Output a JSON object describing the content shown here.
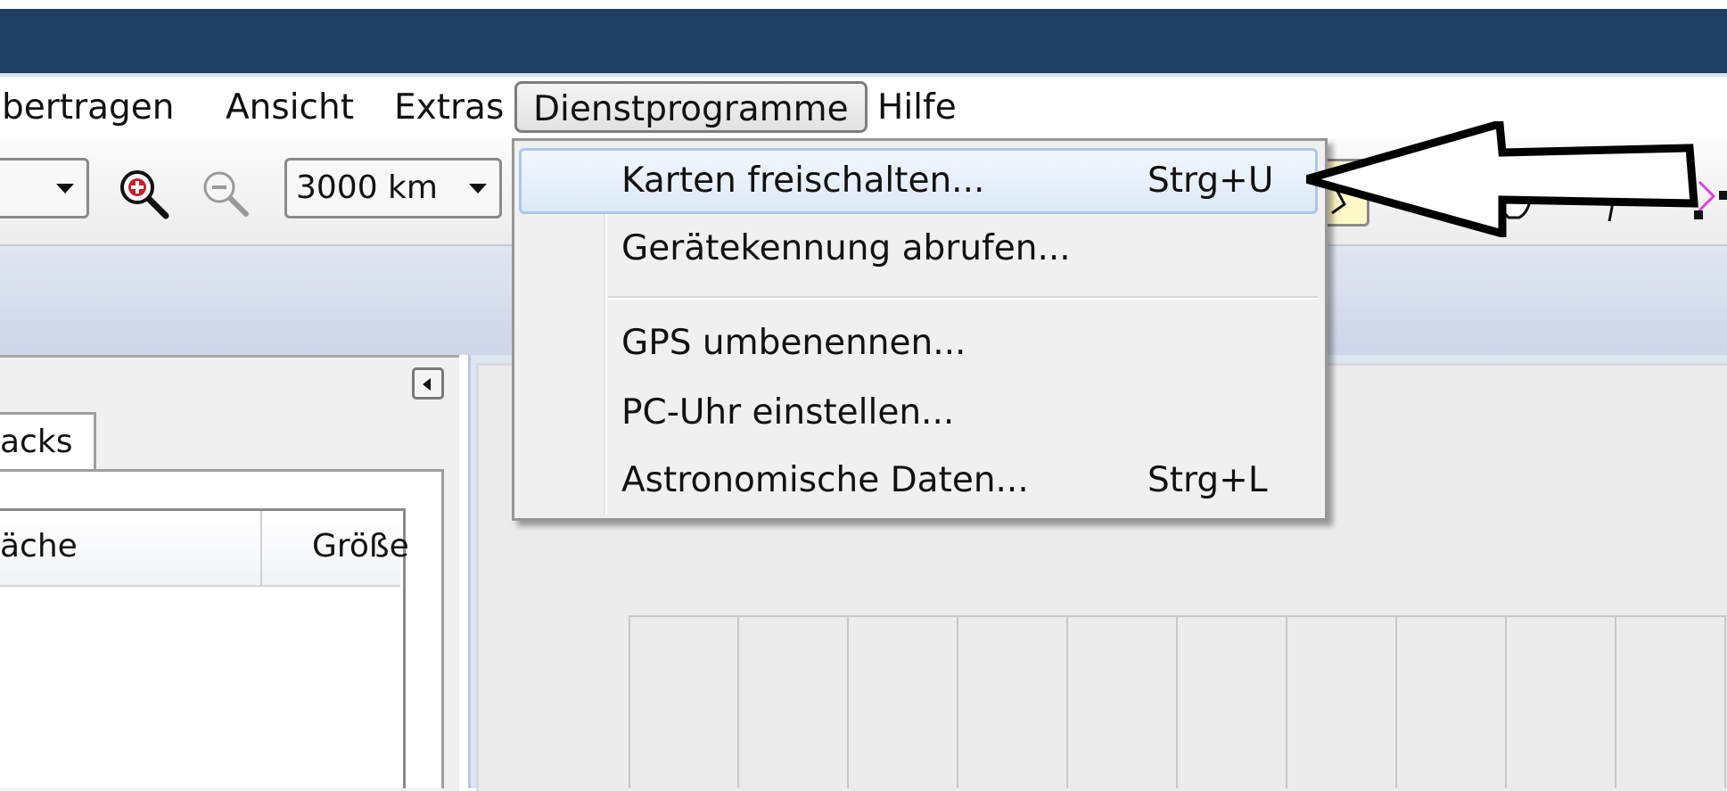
{
  "menubar": {
    "items": [
      "bertragen",
      "Ansicht",
      "Extras",
      "Dienstprogramme",
      "Hilfe"
    ],
    "open_menu": "Dienstprogramme"
  },
  "toolbar": {
    "scale_value": "3000 km",
    "icons": [
      "zoom-in-icon",
      "zoom-out-icon",
      "zoom-tool-icon",
      "pan-hand-icon",
      "flag-icon"
    ]
  },
  "left_panel": {
    "tab_label": "acks",
    "columns": [
      "äche",
      "Größe"
    ]
  },
  "dropdown": {
    "items": [
      {
        "label": "Karten freischalten...",
        "shortcut": "Strg+U",
        "highlighted": true
      },
      {
        "label": "Gerätekennung abrufen...",
        "shortcut": ""
      },
      {
        "label": "GPS umbenennen...",
        "shortcut": ""
      },
      {
        "label": "PC-Uhr einstellen...",
        "shortcut": ""
      },
      {
        "label": "Astronomische Daten...",
        "shortcut": "Strg+L"
      }
    ]
  },
  "annotation": {
    "arrow_color": "#000000",
    "arrow_fill": "#ffffff"
  },
  "colors": {
    "titlebar": "#1f3f63",
    "menu_highlight": "#dde9f8",
    "map_background": "#ececec"
  }
}
